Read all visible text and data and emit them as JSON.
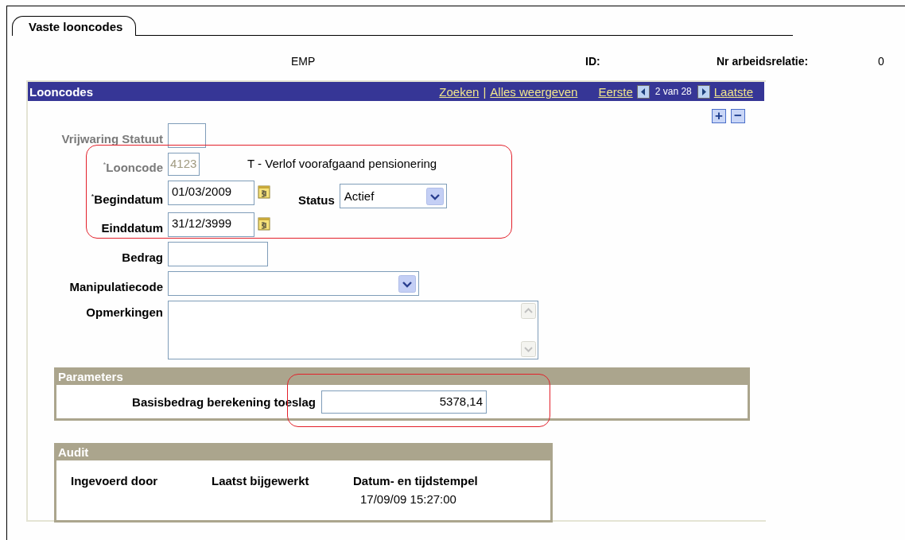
{
  "tab": {
    "label": "Vaste looncodes",
    "selected": true
  },
  "header": [
    {
      "kind": "value",
      "text": "EMP"
    },
    {
      "kind": "label",
      "text": "ID:"
    },
    {
      "kind": "label",
      "text": "Nr arbeidsrelatie:"
    },
    {
      "kind": "value",
      "text": "0"
    }
  ],
  "panel": {
    "title": "Looncodes",
    "links": [
      "Zoeken",
      "Alles weergeven"
    ],
    "separator": "|",
    "first": "Eerste",
    "counter": "2 van 28",
    "last": "Laatste",
    "add": "+",
    "remove": "−",
    "fields": [
      {
        "kind": "flag",
        "label": "Vrijwaring Statuut",
        "disabled": true,
        "highlighted": false
      },
      {
        "kind": "code",
        "label": "$^{*}$Looncode",
        "value": "4123",
        "description": "T - Verlof voorafgaand pensionering",
        "disabled": true,
        "highlighted": true
      },
      {
        "kind": "date",
        "label": "$^{*}$Begindatum",
        "value": "01/03/2009",
        "disabled": false,
        "highlighted": true,
        "side": {
          "label": "Status",
          "value": "Actief"
        }
      },
      {
        "kind": "date",
        "label": "Einddatum",
        "value": "31/12/3999",
        "disabled": false,
        "highlighted": true
      },
      {
        "kind": "text",
        "label": "Bedrag",
        "disabled": false,
        "highlighted": false
      },
      {
        "kind": "select",
        "label": "Manipulatiecode",
        "disabled": false,
        "highlighted": false
      },
      {
        "kind": "textarea",
        "label": "Opmerkingen",
        "disabled": false,
        "highlighted": false
      }
    ],
    "parameters": {
      "title": "Parameters",
      "fields": [
        {
          "label": "Basisbedrag berekening toeslag",
          "value": "5378,14",
          "highlighted": true
        }
      ]
    },
    "audit": {
      "title": "Audit",
      "columns": [
        {
          "label": "Ingevoerd door"
        },
        {
          "label": "Laatst bijgewerkt"
        },
        {
          "label": "Datum- en tijdstempel",
          "value": "17/09/09 15:27:00"
        }
      ]
    }
  }
}
